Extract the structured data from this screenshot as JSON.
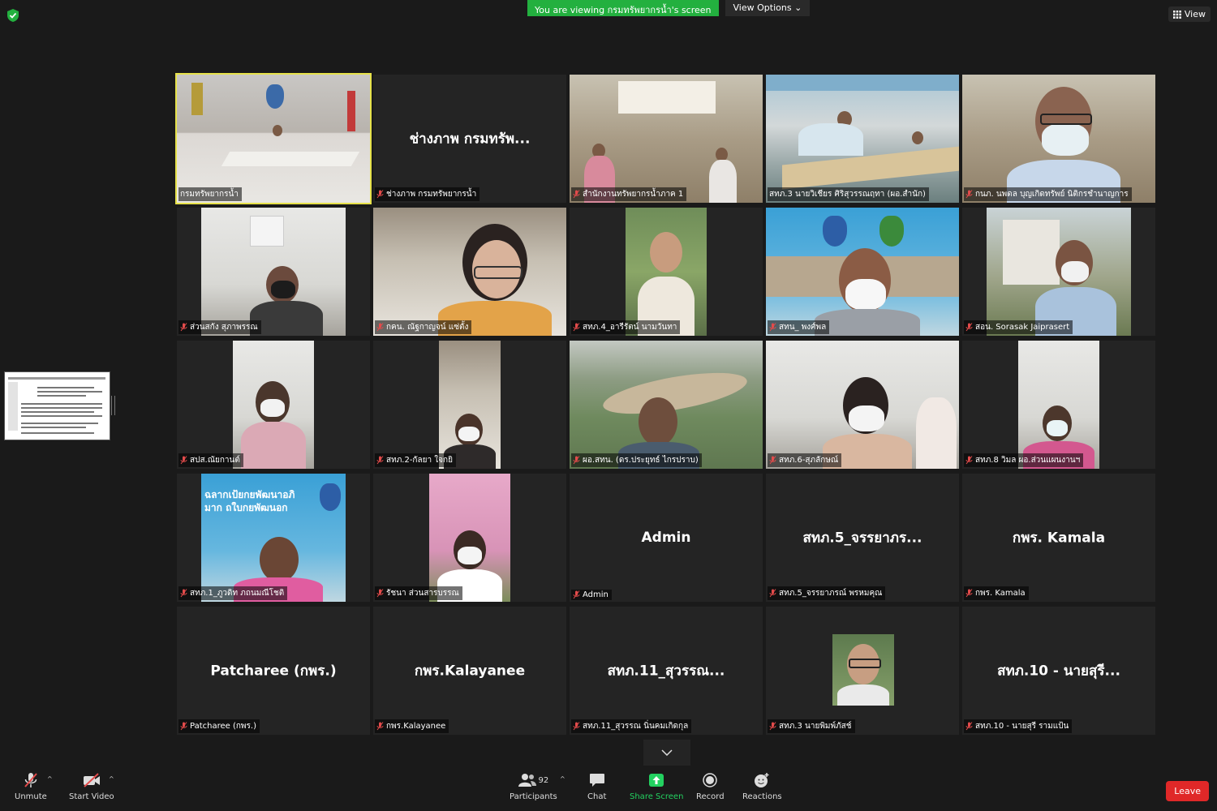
{
  "banner": {
    "viewing": "You are viewing กรมทรัพยากรน้ำ's screen",
    "view_options": "View Options"
  },
  "view_label": "View",
  "tiles": [
    {
      "label": "กรมทรัพยากรน้ำ",
      "big_name": ""
    },
    {
      "label": "ช่างภาพ กรมทรัพยากรน้ำ",
      "big_name": "ช่างภาพ กรมทรัพ..."
    },
    {
      "label": "สำนักงานทรัพยากรน้ำภาค 1",
      "big_name": ""
    },
    {
      "label": "สทภ.3 นายวิเชียร ศิริสุวรรณฤทา (ผอ.สำนัก)",
      "big_name": ""
    },
    {
      "label": "กนภ. นพดล บุญเกิดทรัพย์ นิติกรชำนาญการ",
      "big_name": ""
    },
    {
      "label": "ส่วนสกัง สุภาพรรณ",
      "big_name": ""
    },
    {
      "label": "กคน. ณัฐกาญจน์ แซ่ตั้ง",
      "big_name": ""
    },
    {
      "label": "สทภ.4_อารีรัตน์ นามวันทา",
      "big_name": ""
    },
    {
      "label": "สทน_ พงศ์พล",
      "big_name": ""
    },
    {
      "label": "สอน. Sorasak Jaiprasert",
      "big_name": ""
    },
    {
      "label": "สปส.ณัยกานต์",
      "big_name": ""
    },
    {
      "label": "สทภ.2-กัลยา ใจกยิ",
      "big_name": ""
    },
    {
      "label": "ผอ.สทน. (ดร.ประยุทธ์ ไกรปราบ)",
      "big_name": ""
    },
    {
      "label": "สทภ.6-สุภลักษณ์",
      "big_name": ""
    },
    {
      "label": "สทภ.8 วิมล ผอ.ส่วนแผนงานฯ",
      "big_name": ""
    },
    {
      "label": "สทภ.1_ภูวดิท ภถนมณีโชติ",
      "big_name": ""
    },
    {
      "label": "รัชนา ส่วนสารบรรณ",
      "big_name": ""
    },
    {
      "label": "Admin",
      "big_name": "Admin"
    },
    {
      "label": "สทภ.5_จรรยาภรณ์ พรหมคุณ",
      "big_name": "สทภ.5_จรรยาภร..."
    },
    {
      "label": "กพร. Kamala",
      "big_name": "กพร. Kamala"
    },
    {
      "label": "Patcharee (กพร.)",
      "big_name": "Patcharee (กพร.)"
    },
    {
      "label": "กพร.Kalayanee",
      "big_name": "กพร.Kalayanee"
    },
    {
      "label": "สทภ.11_สุวรรณ นิ่นคมเกิดกุล",
      "big_name": "สทภ.11_สุวรรณ..."
    },
    {
      "label": "สทภ.3 นายพิมพ์ภัสช์",
      "big_name": ""
    },
    {
      "label": "สทภ.10 - นายสุรี รามแป้น",
      "big_name": "สทภ.10 - นายสุรี..."
    }
  ],
  "tile_banner_text": "ฉลากเป้ยกยพัฒนาอภิมาก ถใบกยพัฒนอก",
  "toolbar": {
    "unmute": "Unmute",
    "start_video": "Start Video",
    "participants": "Participants",
    "participants_count": "92",
    "chat": "Chat",
    "share_screen": "Share Screen",
    "record": "Record",
    "reactions": "Reactions",
    "leave": "Leave"
  },
  "colors": {
    "accent_green": "#23b03f",
    "active_tile": "#e6e14a",
    "leave_red": "#e02828"
  }
}
